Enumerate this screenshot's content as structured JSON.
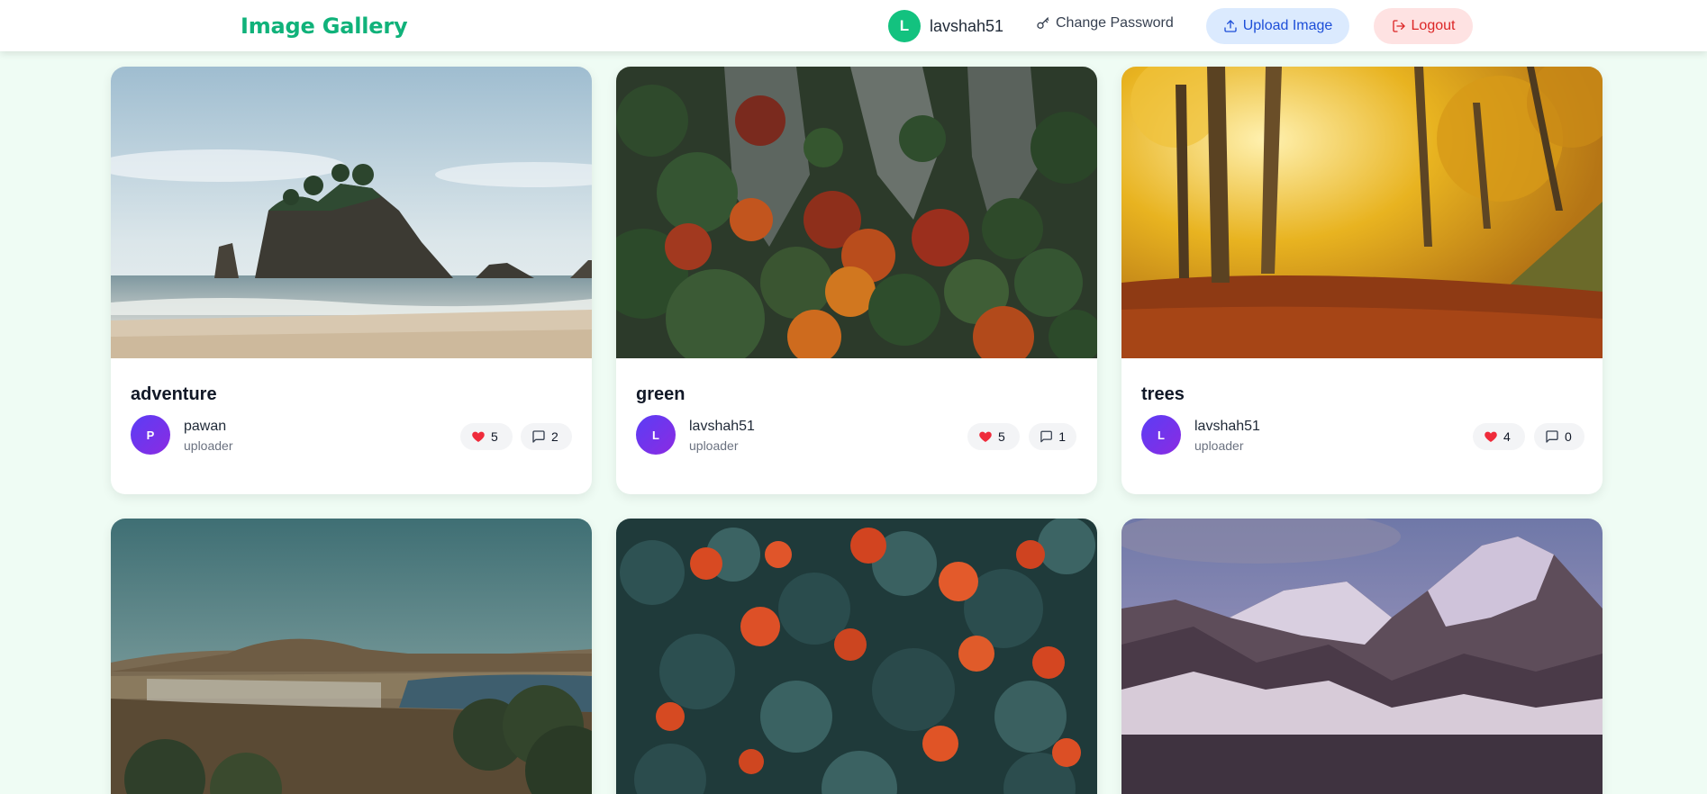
{
  "header": {
    "brand": "Image Gallery",
    "user": {
      "initial": "L",
      "name": "lavshah51"
    },
    "change_password_label": "Change Password",
    "upload_label": "Upload Image",
    "logout_label": "Logout"
  },
  "gallery": {
    "cards": [
      {
        "title": "adventure",
        "uploader": "pawan",
        "uploader_initial": "P",
        "role": "uploader",
        "likes": "5",
        "comments": "2",
        "image": "coastal sea stack with trees at beach"
      },
      {
        "title": "green",
        "uploader": "lavshah51",
        "uploader_initial": "L",
        "role": "uploader",
        "likes": "5",
        "comments": "1",
        "image": "autumn forest on rocky cliff"
      },
      {
        "title": "trees",
        "uploader": "lavshah51",
        "uploader_initial": "L",
        "role": "uploader",
        "likes": "4",
        "comments": "0",
        "image": "golden autumn forest path with leaves"
      },
      {
        "title": "",
        "uploader": "",
        "uploader_initial": "",
        "role": "",
        "likes": "",
        "comments": "",
        "image": "hillside town by bay at dusk"
      },
      {
        "title": "",
        "uploader": "",
        "uploader_initial": "",
        "role": "",
        "likes": "",
        "comments": "",
        "image": "red berries on dark green shrub"
      },
      {
        "title": "",
        "uploader": "",
        "uploader_initial": "",
        "role": "",
        "likes": "",
        "comments": "",
        "image": "snowy mountain peaks at sunset"
      }
    ]
  },
  "colors": {
    "brand": "#10b27a",
    "page_bg": "#effcf4",
    "upload_bg": "#dbeafe",
    "upload_text": "#1d4ed8",
    "logout_bg": "#fee2e2",
    "logout_text": "#dc2626",
    "heart": "#ef2b3b"
  }
}
